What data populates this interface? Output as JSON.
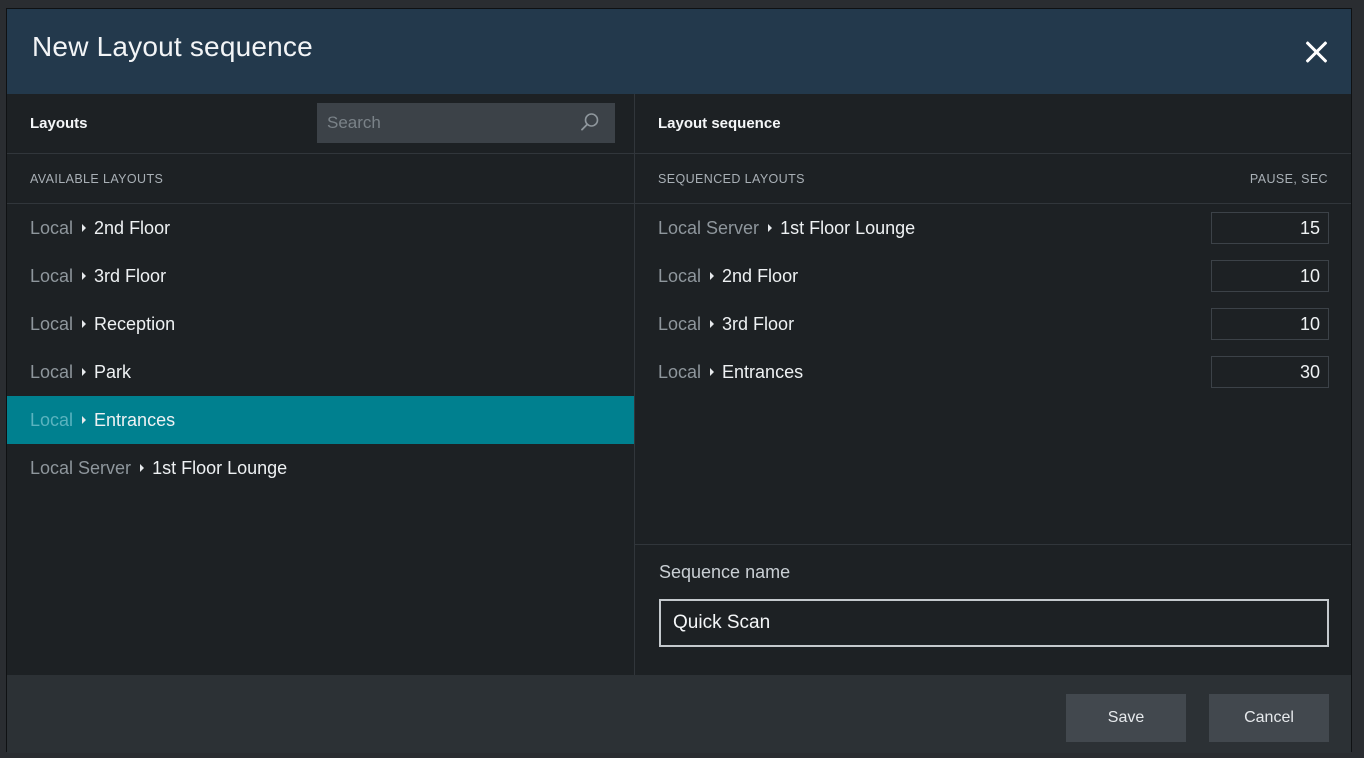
{
  "dialog": {
    "title": "New Layout sequence",
    "close_icon": "close-icon"
  },
  "left": {
    "title": "Layouts",
    "search_placeholder": "Search",
    "search_icon": "search-icon",
    "column_label": "AVAILABLE LAYOUTS",
    "items": [
      {
        "source": "Local",
        "name": "2nd Floor",
        "selected": false
      },
      {
        "source": "Local",
        "name": "3rd Floor",
        "selected": false
      },
      {
        "source": "Local",
        "name": "Reception",
        "selected": false
      },
      {
        "source": "Local",
        "name": "Park",
        "selected": false
      },
      {
        "source": "Local",
        "name": "Entrances",
        "selected": true
      },
      {
        "source": "Local Server",
        "name": "1st Floor Lounge",
        "selected": false
      }
    ]
  },
  "right": {
    "title": "Layout sequence",
    "column_label": "SEQUENCED LAYOUTS",
    "pause_label": "PAUSE, SEC",
    "items": [
      {
        "source": "Local Server",
        "name": "1st Floor Lounge",
        "pause": "15"
      },
      {
        "source": "Local",
        "name": "2nd Floor",
        "pause": "10"
      },
      {
        "source": "Local",
        "name": "3rd Floor",
        "pause": "10"
      },
      {
        "source": "Local",
        "name": "Entrances",
        "pause": "30"
      }
    ],
    "sequence_name_label": "Sequence name",
    "sequence_name_value": "Quick Scan"
  },
  "footer": {
    "save_label": "Save",
    "cancel_label": "Cancel"
  },
  "colors": {
    "titlebar": "#23394c",
    "selected_row": "#00808f",
    "background": "#1d2124",
    "footer": "#2c3135"
  }
}
